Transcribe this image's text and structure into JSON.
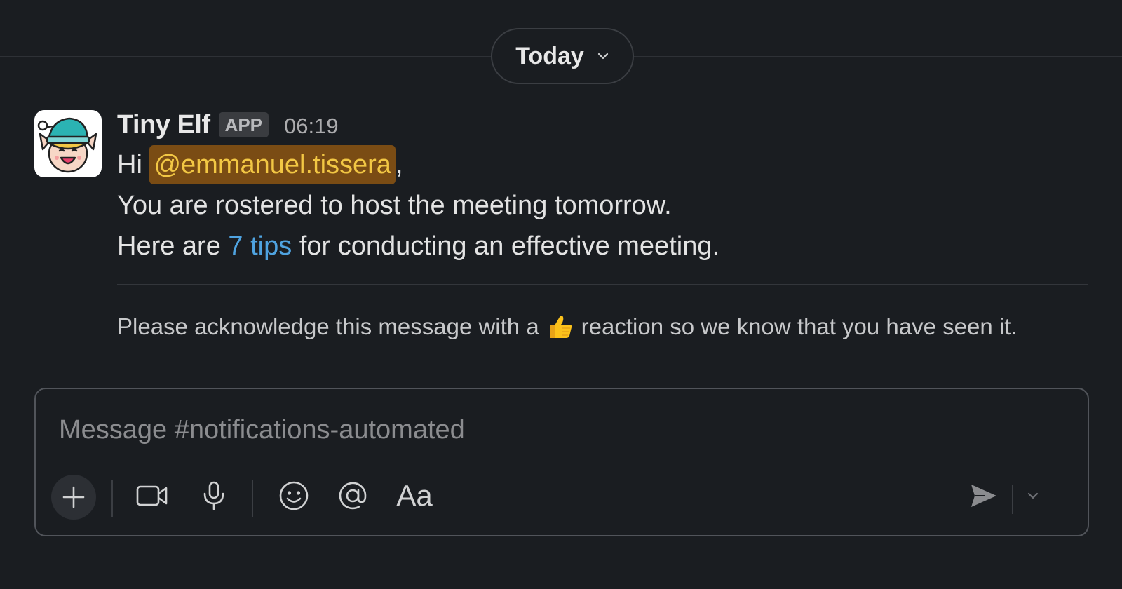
{
  "date_divider": {
    "label": "Today"
  },
  "message": {
    "sender": "Tiny Elf",
    "badge": "APP",
    "time": "06:19",
    "greeting": "Hi",
    "mention": "@emmanuel.tissera",
    "comma": ",",
    "line2": "You are rostered to host the meeting tomorrow.",
    "line3_before": "Here are",
    "line3_link": "7 tips",
    "line3_after": "for conducting an effective meeting.",
    "ack_before": "Please acknowledge this message with a",
    "ack_emoji": "thumbs-up",
    "ack_after": "reaction so we know that you have seen it."
  },
  "composer": {
    "placeholder": "Message #notifications-automated",
    "format_label": "Aa"
  },
  "colors": {
    "background": "#1a1d21",
    "mention_bg": "#7a4c14",
    "mention_text": "#f2c744",
    "link": "#4fa3e0"
  }
}
